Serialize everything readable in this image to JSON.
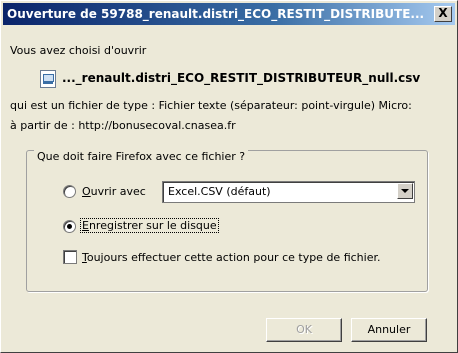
{
  "window": {
    "title": "Ouverture de 59788_renault.distri_ECO_RESTIT_DISTRIBUTE...",
    "close_label": "X"
  },
  "intro": "Vous avez choisi d'ouvrir",
  "file": {
    "icon": "csv-file-icon",
    "name": "..._renault.distri_ECO_RESTIT_DISTRIBUTEUR_null.csv",
    "type_line": "qui est un fichier de type :  Fichier texte (séparateur: point-virgule) Micro:",
    "source_line": "à partir de : http://bonusecoval.cnasea.fr"
  },
  "group": {
    "legend": "Que doit faire Firefox avec ce fichier ?",
    "open_with": {
      "label_key": "O",
      "label_rest": "uvrir avec",
      "selected": false,
      "app": "Excel.CSV (défaut)"
    },
    "save": {
      "label_key": "E",
      "label_rest": "nregistrer sur le disque",
      "selected": true
    },
    "always": {
      "label_key": "T",
      "label_rest": "oujours effectuer cette action pour ce type de fichier.",
      "checked": false
    }
  },
  "buttons": {
    "ok": "OK",
    "cancel": "Annuler"
  }
}
